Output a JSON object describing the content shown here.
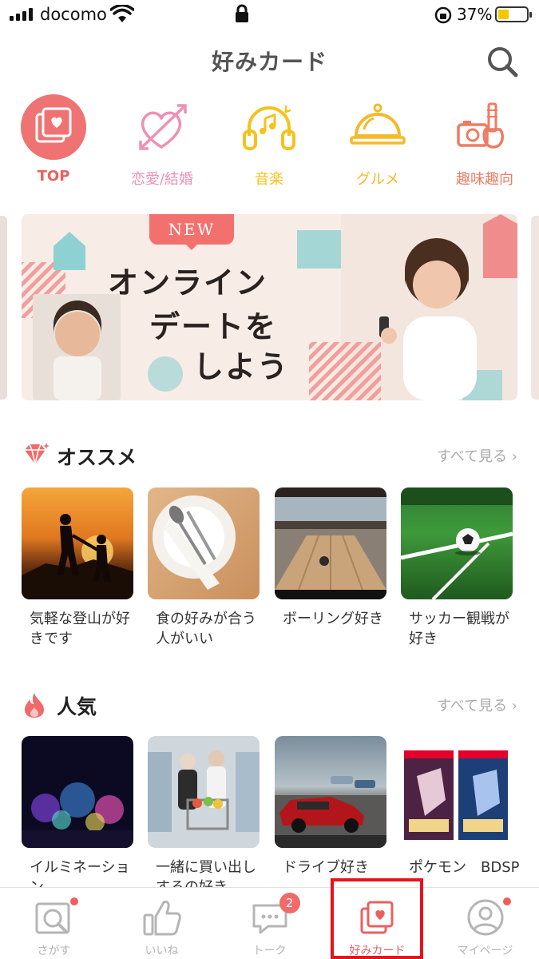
{
  "status_bar": {
    "carrier": "docomo",
    "battery_percent": "37%",
    "battery_level": 0.37
  },
  "header": {
    "title": "好みカード",
    "search_icon": "search-icon"
  },
  "categories": [
    {
      "label": "TOP",
      "icon": "cards-heart-icon",
      "color": "#ef7373"
    },
    {
      "label": "恋愛/結婚",
      "icon": "heart-arrow-icon",
      "color": "#f08fb4"
    },
    {
      "label": "音楽",
      "icon": "headphones-icon",
      "color": "#f5c21b"
    },
    {
      "label": "グルメ",
      "icon": "cloche-icon",
      "color": "#f5b92a"
    },
    {
      "label": "趣味趣向",
      "icon": "camera-guitar-icon",
      "color": "#ee7c63"
    }
  ],
  "banner": {
    "tag": "NEW",
    "lines": [
      "オンライン",
      "デートを",
      "しよう"
    ]
  },
  "sections": {
    "recommended": {
      "title": "オススメ",
      "see_all": "すべて見る",
      "icon": "diamond-icon",
      "items": [
        {
          "caption": "気軽な登山が好きです"
        },
        {
          "caption": "食の好みが合う人がいい"
        },
        {
          "caption": "ボーリング好き"
        },
        {
          "caption": "サッカー観戦が好き"
        }
      ]
    },
    "popular": {
      "title": "人気",
      "see_all": "すべて見る",
      "icon": "flame-icon",
      "items": [
        {
          "caption": "イルミネーション"
        },
        {
          "caption": "一緒に買い出しするの好き"
        },
        {
          "caption": "ドライブ好き"
        },
        {
          "caption": "ポケモン　BDSP"
        }
      ]
    }
  },
  "tabbar": {
    "tabs": [
      {
        "label": "さがす",
        "icon": "search-tab-icon",
        "dot": true
      },
      {
        "label": "いいね",
        "icon": "thumbs-up-icon",
        "dot": false
      },
      {
        "label": "トーク",
        "icon": "chat-icon",
        "badge": "2"
      },
      {
        "label": "好みカード",
        "icon": "cards-heart-icon",
        "active": true
      },
      {
        "label": "マイページ",
        "icon": "person-icon",
        "dot": true
      }
    ]
  },
  "colors": {
    "accent": "#ec5f5f",
    "highlight_box": "#e6121d"
  }
}
